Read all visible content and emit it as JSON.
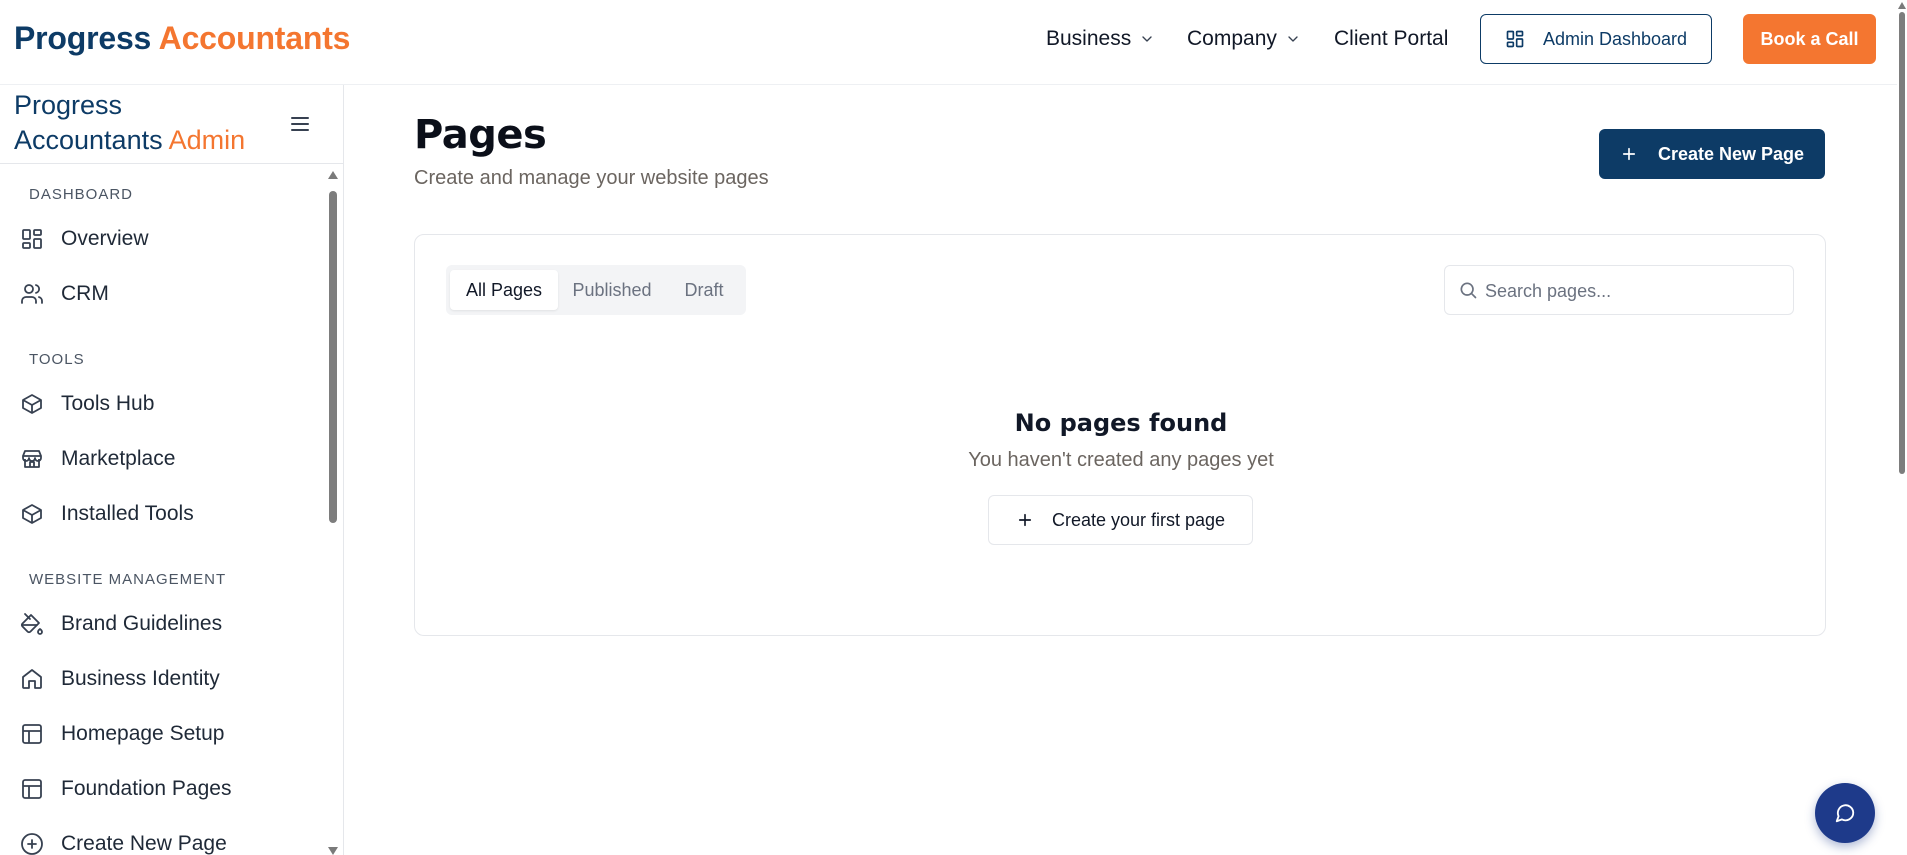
{
  "topnav": {
    "brand_part1": "Progress",
    "brand_part2": "Accountants",
    "links": [
      {
        "label": "Business",
        "dropdown": true
      },
      {
        "label": "Company",
        "dropdown": true
      },
      {
        "label": "Client Portal",
        "dropdown": false
      }
    ],
    "admin_button": "Admin Dashboard",
    "call_button": "Book a Call"
  },
  "sidebar": {
    "title_line1": "Progress",
    "title_line2": "Accountants",
    "title_admin": "Admin",
    "sections": [
      {
        "label": "DASHBOARD",
        "items": [
          {
            "label": "Overview",
            "icon": "layout-dashboard-icon"
          },
          {
            "label": "CRM",
            "icon": "users-icon"
          }
        ]
      },
      {
        "label": "TOOLS",
        "items": [
          {
            "label": "Tools Hub",
            "icon": "box-icon"
          },
          {
            "label": "Marketplace",
            "icon": "store-icon"
          },
          {
            "label": "Installed Tools",
            "icon": "box-icon"
          }
        ]
      },
      {
        "label": "WEBSITE MANAGEMENT",
        "items": [
          {
            "label": "Brand Guidelines",
            "icon": "paint-bucket-icon"
          },
          {
            "label": "Business Identity",
            "icon": "home-icon"
          },
          {
            "label": "Homepage Setup",
            "icon": "layout-icon"
          },
          {
            "label": "Foundation Pages",
            "icon": "layout-icon"
          },
          {
            "label": "Create New Page",
            "icon": "plus-circle-icon"
          }
        ]
      }
    ]
  },
  "main": {
    "title": "Pages",
    "subtitle": "Create and manage your website pages",
    "create_button": "Create New Page",
    "tabs": [
      {
        "label": "All Pages",
        "active": true
      },
      {
        "label": "Published",
        "active": false
      },
      {
        "label": "Draft",
        "active": false
      }
    ],
    "search_placeholder": "Search pages...",
    "search_value": "",
    "empty_title": "No pages found",
    "empty_subtitle": "You haven't created any pages yet",
    "empty_button": "Create your first page"
  },
  "colors": {
    "brand_navy": "#0d3b66",
    "brand_orange": "#f47630",
    "chat_blue": "#1e3a8a"
  }
}
